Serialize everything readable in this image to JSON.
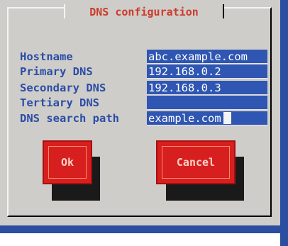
{
  "dialog": {
    "title": "DNS configuration"
  },
  "fields": [
    {
      "label": "Hostname",
      "value": "abc.example.com"
    },
    {
      "label": "Primary DNS",
      "value": "192.168.0.2"
    },
    {
      "label": "Secondary DNS",
      "value": "192.168.0.3"
    },
    {
      "label": "Tertiary DNS",
      "value": ""
    },
    {
      "label": "DNS search path",
      "value": "example.com"
    }
  ],
  "buttons": {
    "ok": "Ok",
    "cancel": "Cancel"
  },
  "colors": {
    "title": "#cc3b2c",
    "label": "#2b4da6",
    "field_bg": "#2f56b2",
    "button": "#d81f1f",
    "dialog_bg": "#cfcdc9"
  }
}
